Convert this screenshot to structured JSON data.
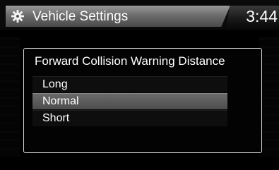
{
  "header": {
    "title": "Vehicle Settings",
    "clock": "3:44",
    "icon": "gear-icon"
  },
  "dialog": {
    "title": "Forward Collision Warning Distance",
    "options": [
      {
        "label": "Long",
        "selected": false
      },
      {
        "label": "Normal",
        "selected": true
      },
      {
        "label": "Short",
        "selected": false
      }
    ]
  },
  "colors": {
    "background": "#000000",
    "header_left": "#7a7a7a",
    "selected_row": "#5a5a5a",
    "dialog_border": "#d9d9d9"
  }
}
